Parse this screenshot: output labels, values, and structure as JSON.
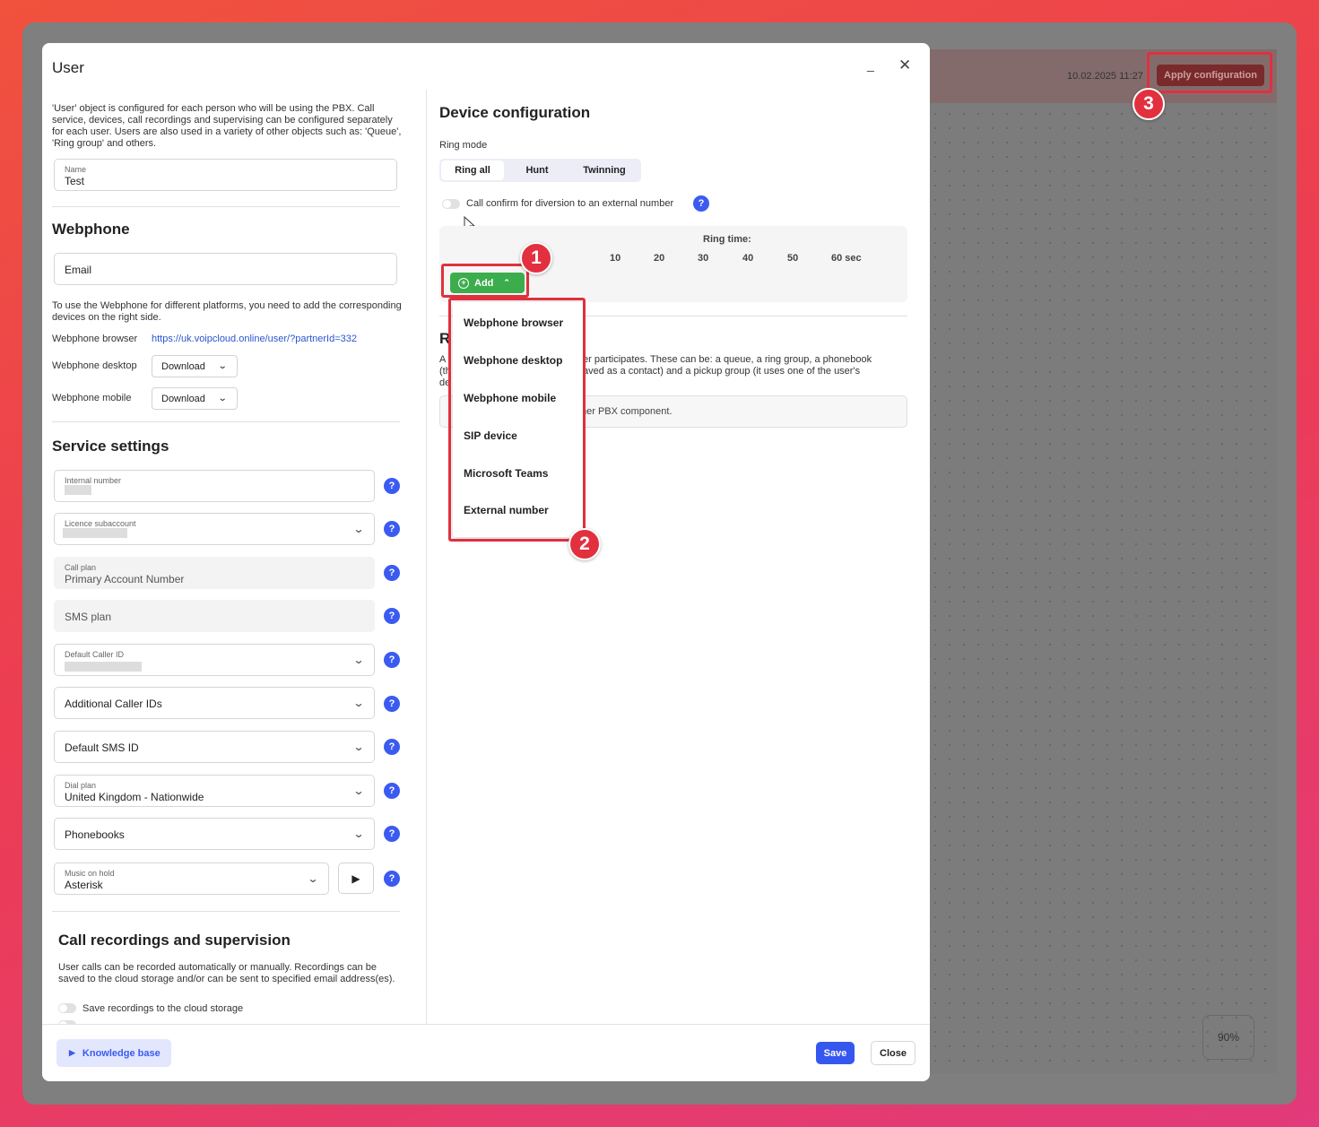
{
  "background": {
    "date": "10.02.2025 11:27",
    "apply_config": "Apply configuration",
    "zoom": "90%"
  },
  "badges": [
    "1",
    "2",
    "3"
  ],
  "dialog": {
    "title": "User",
    "intro": "'User' object is configured for each person who will be using the PBX. Call service, devices, call recordings and supervising can be configured separately for each user. Users are also used in a variety of other objects such as: 'Queue', 'Ring group' and others.",
    "name": {
      "label": "Name",
      "value": "Test"
    },
    "webphone": {
      "heading": "Webphone",
      "email_label": "Email",
      "info": "To use the Webphone for different platforms, you need to add the corresponding devices on the right side.",
      "browser_label": "Webphone browser",
      "browser_link": "https://uk.voipcloud.online/user/?partnerId=332",
      "desktop_label": "Webphone desktop",
      "mobile_label": "Webphone mobile",
      "download": "Download"
    },
    "service": {
      "heading": "Service settings",
      "internal_number": "Internal number",
      "licence_subaccount": "Licence subaccount",
      "call_plan_label": "Call plan",
      "call_plan_value": "Primary Account Number",
      "sms_plan": "SMS plan",
      "default_caller_id": "Default Caller ID",
      "additional_caller_ids": "Additional Caller IDs",
      "default_sms_id": "Default SMS ID",
      "dial_plan_label": "Dial plan",
      "dial_plan_value": "United Kingdom - Nationwide",
      "phonebooks": "Phonebooks",
      "moh_label": "Music on hold",
      "moh_value": "Asterisk"
    },
    "recordings": {
      "heading": "Call recordings and supervision",
      "info": "User calls can be recorded automatically or manually. Recordings can be saved to the cloud storage and/or can be sent to specified email address(es).",
      "save_cloud": "Save recordings to the cloud storage"
    },
    "device": {
      "heading": "Device configuration",
      "ring_mode_label": "Ring mode",
      "ring_modes": [
        "Ring all",
        "Hunt",
        "Twinning"
      ],
      "call_confirm": "Call confirm for diversion to an external number",
      "ring_time_label": "Ring time:",
      "ring_ticks": [
        "10",
        "20",
        "30",
        "40",
        "50",
        "60 sec"
      ],
      "add_label": "Add",
      "add_menu": [
        "Webphone browser",
        "Webphone desktop",
        "Webphone mobile",
        "SIP device",
        "Microsoft Teams",
        "External number"
      ]
    },
    "groups": {
      "heading_fragment": "R",
      "line1_a": "A",
      "line1_b": "er participates. These can be: a queue, a ring group, a phonebook",
      "line2_a": "(th",
      "line2_b": "aved as a contact) and a pickup group (it uses one of the user's",
      "line3_a": "de",
      "empty_fragment": "her PBX component."
    },
    "footer": {
      "knowledge_base": "Knowledge base",
      "save": "Save",
      "close": "Close"
    }
  },
  "colors": {
    "accent": "#3b5bf0",
    "add_green": "#3cad4c",
    "highlight_red": "#e0303e"
  }
}
